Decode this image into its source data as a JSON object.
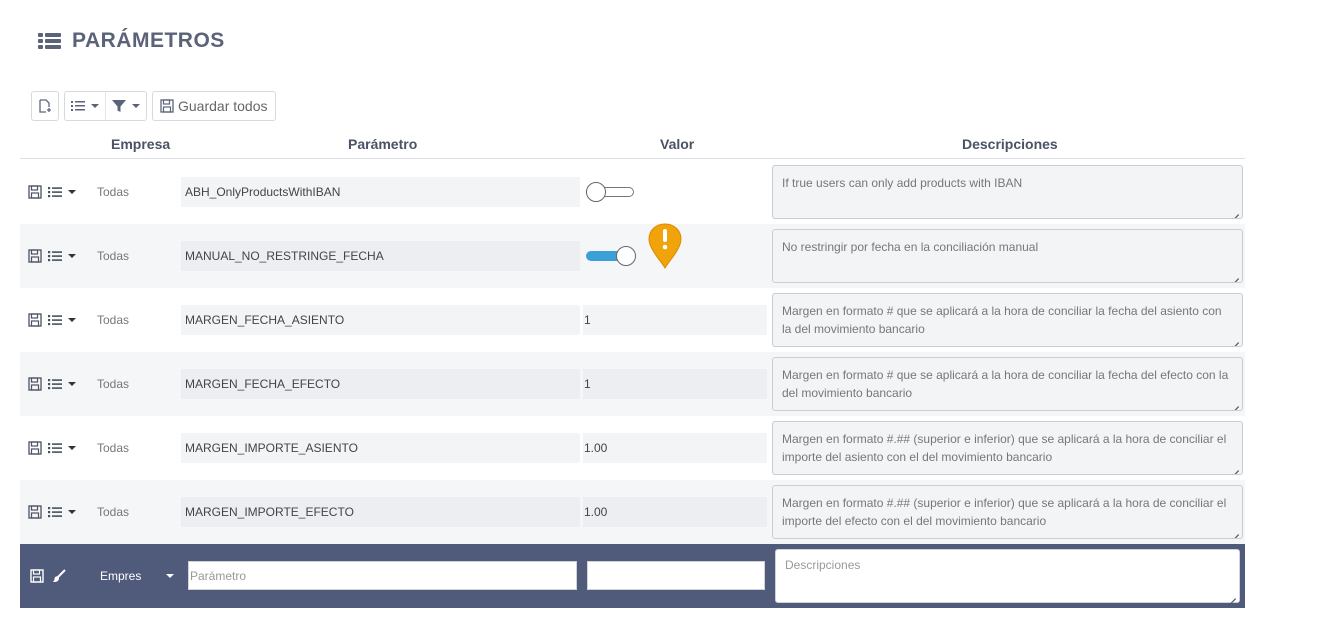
{
  "page": {
    "title": "PARÁMETROS",
    "title_icon": "list-icon"
  },
  "toolbar": {
    "new_icon": "new-document-icon",
    "view_icon": "list-view-icon",
    "filter_icon": "filter-icon",
    "save_all_icon": "save-icon",
    "save_all_label": "Guardar todos"
  },
  "table": {
    "headers": {
      "empresa": "Empresa",
      "parametro": "Parámetro",
      "valor": "Valor",
      "descripciones": "Descripciones"
    },
    "rows": [
      {
        "empresa": "Todas",
        "parametro": "ABH_OnlyProductsWithIBAN",
        "valor_type": "toggle",
        "valor_on": false,
        "valor": "",
        "descripcion": "If true users can only add products with IBAN"
      },
      {
        "empresa": "Todas",
        "parametro": "MANUAL_NO_RESTRINGE_FECHA",
        "valor_type": "toggle",
        "valor_on": true,
        "valor": "",
        "descripcion": "No restringir por fecha en la conciliación manual"
      },
      {
        "empresa": "Todas",
        "parametro": "MARGEN_FECHA_ASIENTO",
        "valor_type": "text",
        "valor": "1",
        "descripcion": "Margen en formato # que se aplicará a la hora de conciliar la fecha del asiento con la del movimiento bancario"
      },
      {
        "empresa": "Todas",
        "parametro": "MARGEN_FECHA_EFECTO",
        "valor_type": "text",
        "valor": "1",
        "descripcion": "Margen en formato # que se aplicará a la hora de conciliar la fecha del efecto con la del movimiento bancario"
      },
      {
        "empresa": "Todas",
        "parametro": "MARGEN_IMPORTE_ASIENTO",
        "valor_type": "text",
        "valor": "1.00",
        "descripcion": "Margen en formato #.## (superior e inferior) que se aplicará a la hora de conciliar el importe del asiento con el del movimiento bancario"
      },
      {
        "empresa": "Todas",
        "parametro": "MARGEN_IMPORTE_EFECTO",
        "valor_type": "text",
        "valor": "1.00",
        "descripcion": "Margen en formato #.## (superior e inferior) que se aplicará a la hora de conciliar el importe del efecto con el del movimiento bancario"
      }
    ],
    "new_row": {
      "empresa": "Empres",
      "parametro_placeholder": "Parámetro",
      "valor": "",
      "descripcion_placeholder": "Descripciones"
    }
  },
  "warning_marker": {
    "icon": "warning-pin-icon",
    "color": "#f0a30a"
  },
  "colors": {
    "header_text": "#5a6378",
    "new_row_bg": "#505a7a",
    "toggle_on": "#3aa0d8"
  }
}
